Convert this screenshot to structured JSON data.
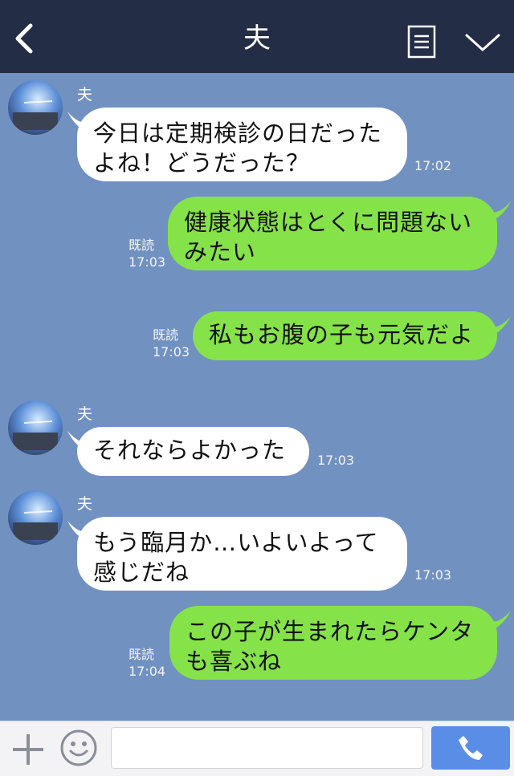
{
  "header": {
    "title": "夫",
    "back_icon": "chevron-left-icon",
    "memo_icon": "memo-icon",
    "menu_icon": "chevron-down-icon"
  },
  "messages": [
    {
      "dir": "in",
      "sender": "夫",
      "lines": [
        "今日は定期検診の日だった",
        "よね！どうだった？"
      ],
      "time": "17:02"
    },
    {
      "dir": "out",
      "read": "既読",
      "lines": [
        "健康状態はとくに問題ない",
        "みたい"
      ],
      "time": "17:03"
    },
    {
      "dir": "out",
      "read": "既読",
      "lines": [
        "私もお腹の子も元気だよ"
      ],
      "time": "17:03"
    },
    {
      "dir": "in",
      "sender": "夫",
      "lines": [
        "それならよかった"
      ],
      "time": "17:03"
    },
    {
      "dir": "in",
      "sender": "夫",
      "lines": [
        "もう臨月か…いよいよって",
        "感じだね"
      ],
      "time": "17:03"
    },
    {
      "dir": "out",
      "read": "既読",
      "lines": [
        "この子が生まれたらケンタ",
        "も喜ぶね"
      ],
      "time": "17:04"
    }
  ],
  "footer": {
    "input_value": "",
    "input_placeholder": "",
    "plus_icon": "plus-icon",
    "sticker_icon": "smiley-icon",
    "call_icon": "phone-icon"
  },
  "colors": {
    "header_bg": "#232d45",
    "chat_bg": "#7191c1",
    "incoming_bubble": "#ffffff",
    "outgoing_bubble": "#85e249",
    "call_button": "#5a8de6"
  }
}
